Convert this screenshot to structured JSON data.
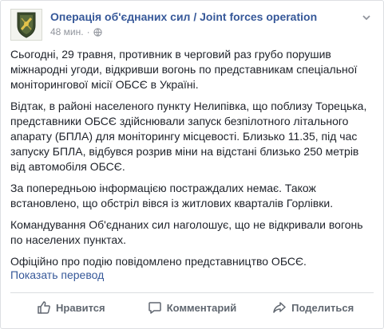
{
  "post": {
    "page_name": "Операція об'єднаних сил / Joint forces operation",
    "time": "48 мин.",
    "separator": "·",
    "privacy_icon": "globe-icon",
    "options_icon": "chevron-down-icon",
    "paragraphs": [
      "Сьогодні, 29 травня, противник в черговий раз грубо порушив міжнародні угоди, відкривши вогонь по представникам спеціальної моніторингової місії ОБСЄ в Україні.",
      "Відтак, в районі населеного пункту Нелипівка, що поблизу Торецька, представники ОБСЄ здійснювали запуск безпілотного літального апарату (БПЛА) для моніторингу місцевості. Близько 11.35, під час запуску БПЛА, відбувся розрив міни на відстані близько 250 метрів від автомобіля ОБСЄ.",
      "За попередньою інформацією постраждалих немає. Також встановлено, що обстріл вівся із житлових кварталів Горлівки.",
      "Командування Об'єднаних сил наголошує, що не відкривали вогонь по населених пунктах.",
      "Офіційно про подію повідомлено представництво ОБСЄ."
    ],
    "see_translation": "Показать перевод"
  },
  "actions": {
    "like_label": "Нравится",
    "comment_label": "Комментарий",
    "share_label": "Поделиться"
  },
  "colors": {
    "link": "#365899",
    "text": "#1d2129",
    "muted": "#90949c",
    "action": "#606770"
  }
}
